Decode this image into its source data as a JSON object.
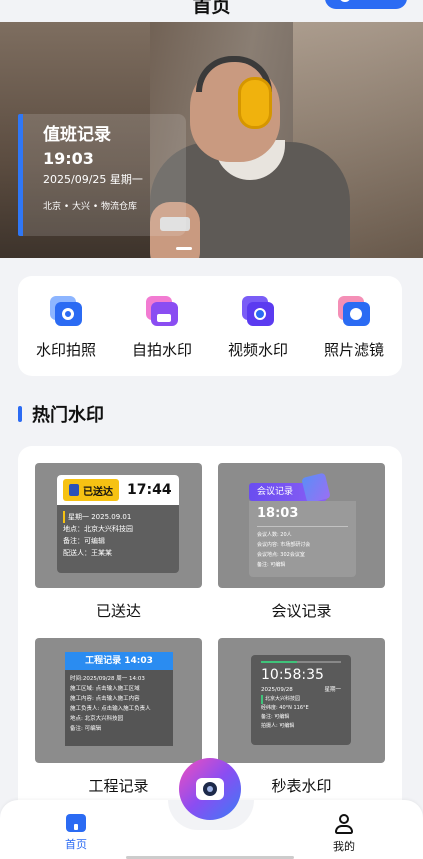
{
  "header": {
    "title": "首页"
  },
  "banner": {
    "title": "值班记录",
    "time": "19:03",
    "date": "2025/09/25 星期一",
    "location": "北京 • 大兴 • 物流仓库"
  },
  "tools": [
    {
      "label": "水印拍照",
      "icon": "camera-watermark-icon",
      "color": "#2b6bf3"
    },
    {
      "label": "自拍水印",
      "icon": "selfie-image-icon",
      "color": "#8a4df2"
    },
    {
      "label": "视频水印",
      "icon": "video-icon",
      "color": "#5b3bf0"
    },
    {
      "label": "照片滤镜",
      "icon": "filter-icon",
      "color": "#2b6bf3"
    }
  ],
  "section": {
    "title": "热门水印"
  },
  "cards": {
    "delivered": {
      "label": "已送达",
      "badge": "已送达",
      "time": "17:44",
      "rows": [
        "星期一  2025.09.01",
        "地点：北京大兴科技园",
        "备注：可编辑",
        "配送人：王某某"
      ]
    },
    "meeting": {
      "label": "会议记录",
      "ribbon": "会议记录",
      "time": "18:03",
      "rows": [
        "会议人数: 20人",
        "会议内容: 市场部研讨会",
        "会议地点: 302会议室",
        "备注: 可编辑"
      ]
    },
    "engineering": {
      "label": "工程记录",
      "bar": "工程记录 14:03",
      "rows": [
        "时间:2025/09/28 周一 14:03",
        "施工区域: 点击输入施工区域",
        "施工内容: 点击输入施工内容",
        "施工负责人: 点击输入施工负责人",
        "地点: 北京大兴科技园",
        "备注: 可编辑"
      ]
    },
    "stopwatch": {
      "label": "秒表水印",
      "time": "10:58:35",
      "date": "2025/09/28",
      "weekday": "星期一",
      "rows": [
        "北京大兴科技园",
        "经纬度: 40°N 116°E",
        "备注: 可编辑",
        "拍摄人: 可编辑"
      ]
    }
  },
  "nav": {
    "home": "首页",
    "me": "我的"
  }
}
